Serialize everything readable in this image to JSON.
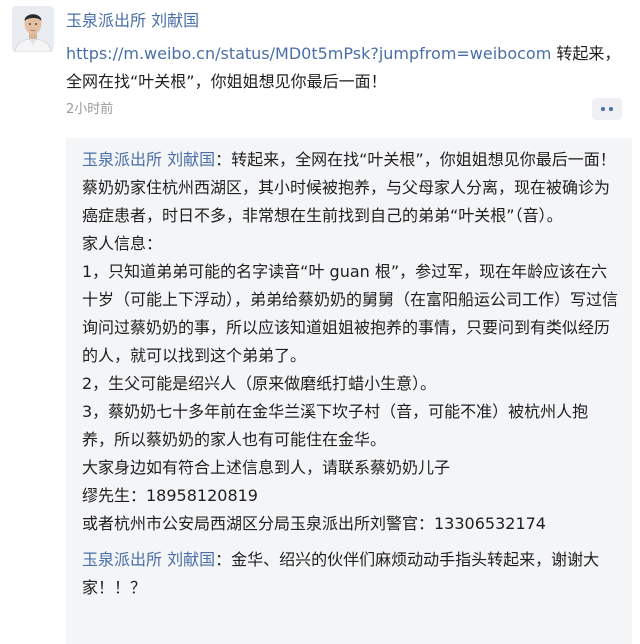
{
  "post": {
    "author": "玉泉派出所 刘献国",
    "link_text": "https://m.weibo.cn/status/MD0t5mPsk?jumpfrom=weibocom",
    "text_after_link": " 转起来，全网在找“叶关根”，你姐姐想见你最后一面！",
    "timestamp": "2小时前",
    "more_icon": "more-dots-icon"
  },
  "comments": [
    {
      "author": "玉泉派出所 刘献国",
      "separator": "：",
      "lines": [
        "转起来，全网在找“叶关根”，你姐姐想见你最后一面！",
        "蔡奶奶家住杭州西湖区，其小时候被抱养，与父母家人分离，现在被确诊为癌症患者，时日不多，非常想在生前找到自己的弟弟“叶关根”（音）。",
        "家人信息：",
        "1，只知道弟弟可能的名字读音“叶 guan 根”，参过军，现在年龄应该在六十岁（可能上下浮动），弟弟给蔡奶奶的舅舅（在富阳船运公司工作）写过信询问过蔡奶奶的事，所以应该知道姐姐被抱养的事情，只要问到有类似经历的人，就可以找到这个弟弟了。",
        "2，生父可能是绍兴人（原来做磨纸打蜡小生意）。",
        "3，蔡奶奶七十多年前在金华兰溪下坎子村（音，可能不准）被杭州人抱养，所以蔡奶奶的家人也有可能住在金华。",
        "大家身边如有符合上述信息到人，请联系蔡奶奶儿子",
        "缪先生：18958120819",
        "或者杭州市公安局西湖区分局玉泉派出所刘警官：13306532174"
      ]
    },
    {
      "author": "玉泉派出所 刘献国",
      "separator": "：",
      "lines": [
        "金华、绍兴的伙伴们麻烦动动手指头转起来，谢谢大家！！？"
      ]
    }
  ]
}
